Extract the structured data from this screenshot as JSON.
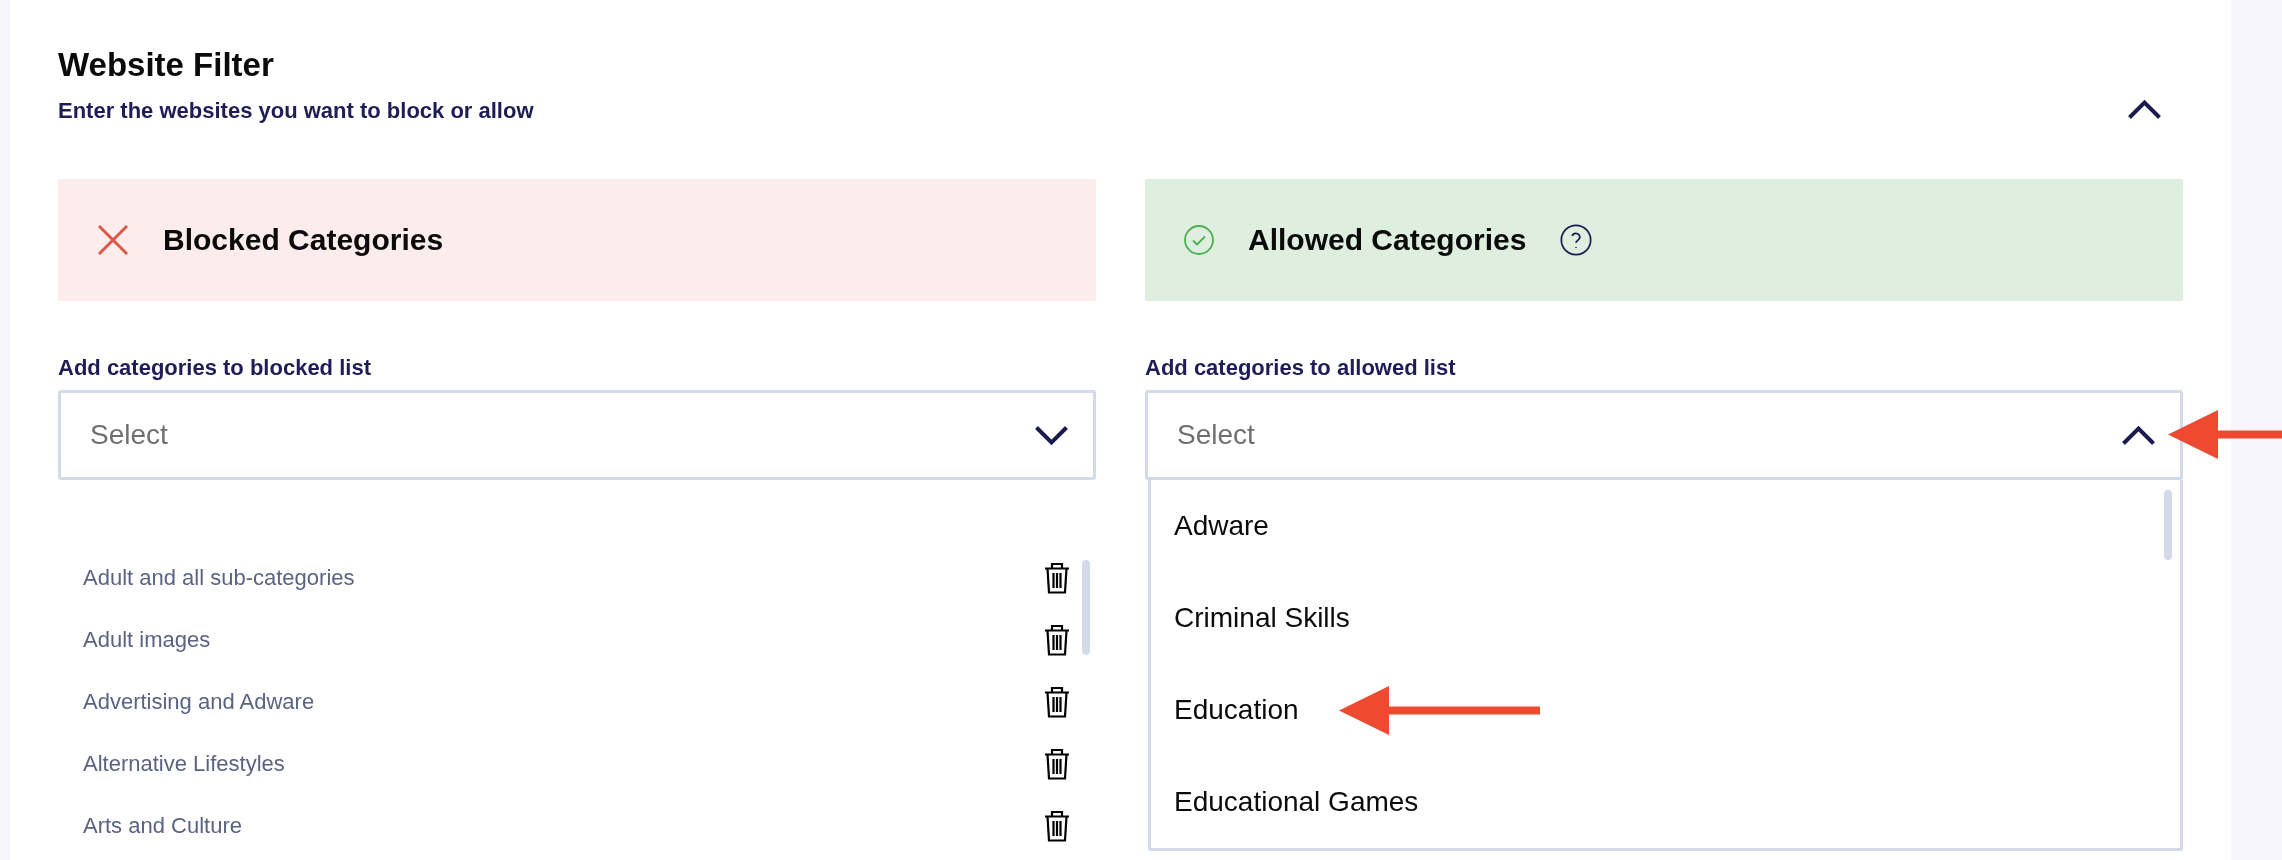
{
  "section": {
    "title": "Website Filter",
    "subtitle": "Enter the websites you want to block or allow",
    "expanded": true
  },
  "columns": [
    {
      "kind": "blocked",
      "heading": "Blocked Categories",
      "has_help": false,
      "select": {
        "label": "Add categories to blocked list",
        "placeholder": "Select",
        "expanded": false,
        "arrow": false
      },
      "items": [
        "Adult and all sub-categories",
        "Adult images",
        "Advertising and Adware",
        "Alternative Lifestyles",
        "Arts and Culture"
      ]
    },
    {
      "kind": "allowed",
      "heading": "Allowed Categories",
      "has_help": true,
      "select": {
        "label": "Add categories to allowed list",
        "placeholder": "Select",
        "expanded": true,
        "arrow": true,
        "options": [
          {
            "label": "Adware",
            "arrow": false
          },
          {
            "label": "Criminal Skills",
            "arrow": false
          },
          {
            "label": "Education",
            "arrow": true
          },
          {
            "label": "Educational Games",
            "arrow": false
          }
        ]
      }
    }
  ]
}
